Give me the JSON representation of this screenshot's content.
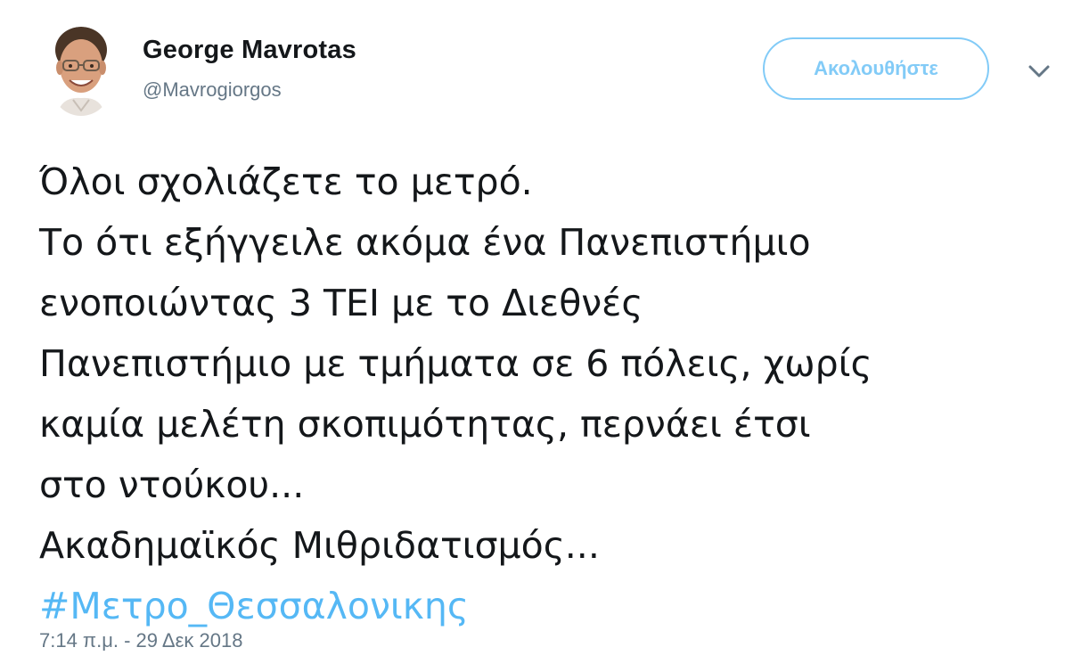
{
  "author": {
    "name": "George Mavrotas",
    "handle": "@Mavrogiorgos",
    "avatar_icon": "profile-photo"
  },
  "actions": {
    "follow_label": "Ακολουθήστε",
    "menu_icon": "chevron-down-icon"
  },
  "tweet": {
    "lines": [
      "Όλοι σχολιάζετε το μετρό.",
      "Το ότι εξήγγειλε ακόμα ένα Πανεπιστήμιο",
      "ενοποιώντας 3 ΤΕΙ με το Διεθνές",
      "Πανεπιστήμιο με τμήματα σε 6 πόλεις, χωρίς",
      "καμία μελέτη σκοπιμότητας, περνάει έτσι",
      "στο ντούκου...",
      "Ακαδημαϊκός Μιθριδατισμός..."
    ],
    "hashtag": "#Μετρο_Θεσσαλονικης",
    "timestamp": "7:14 π.μ. - 29 Δεκ 2018"
  },
  "colors": {
    "accent": "#1da1f2",
    "text": "#14171a",
    "secondary": "#657786"
  }
}
